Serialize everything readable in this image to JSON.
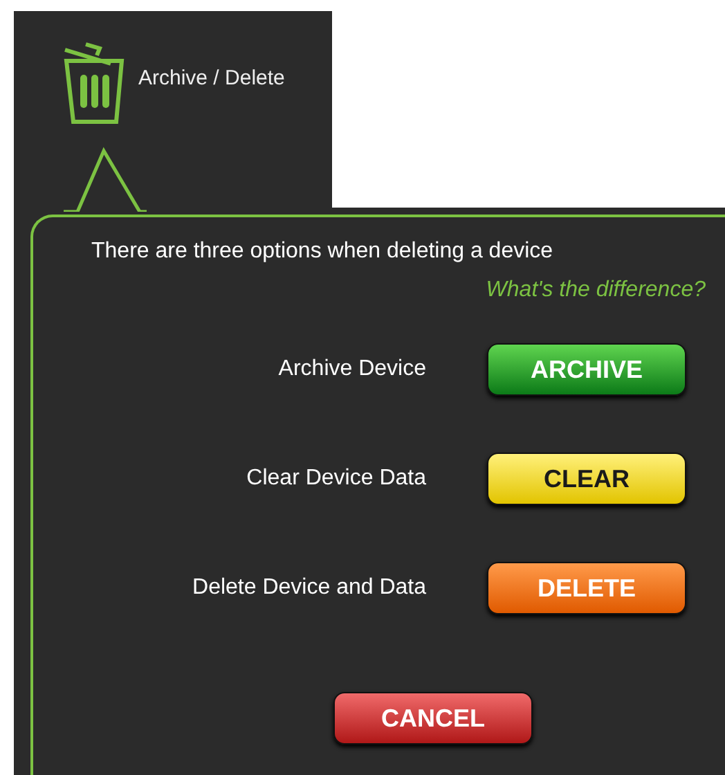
{
  "header": {
    "title": "Archive / Delete"
  },
  "dialog": {
    "intro": "There are three options when deleting a device",
    "help_link": "What's the difference?",
    "options": [
      {
        "label": "Archive Device",
        "button": "ARCHIVE",
        "kind": "archive"
      },
      {
        "label": "Clear Device Data",
        "button": "CLEAR",
        "kind": "clear"
      },
      {
        "label": "Delete Device and Data",
        "button": "DELETE",
        "kind": "delete"
      }
    ],
    "cancel": {
      "button": "CANCEL",
      "kind": "cancel"
    }
  }
}
